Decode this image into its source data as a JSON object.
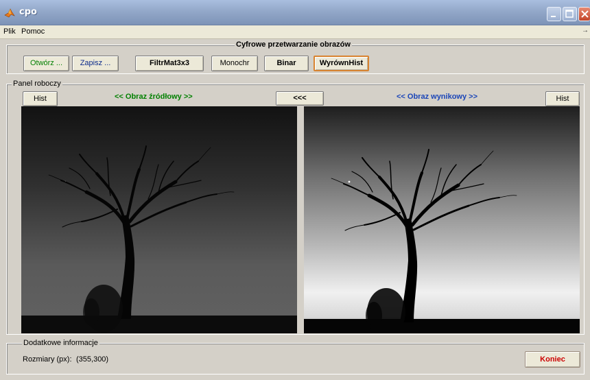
{
  "window": {
    "title": "cpo"
  },
  "menu": {
    "items": [
      "Plik",
      "Pomoc"
    ],
    "overflow_arrow": "→"
  },
  "toolbar": {
    "title": "Cyfrowe przetwarzanie obrazów",
    "open_label": "Otwórz ...",
    "save_label": "Zapisz ...",
    "filter_label": "FiltrMat3x3",
    "mono_label": "Monochr",
    "binar_label": "Binar",
    "histeq_label": "WyrównHist"
  },
  "work": {
    "title": "Panel roboczy",
    "hist_left_label": "Hist",
    "source_label": "<< Obraz źródłowy >>",
    "copy_back_label": "<<<",
    "result_label": "<< Obraz wynikowy >>",
    "hist_right_label": "Hist"
  },
  "info": {
    "title": "Dodatkowe informacje",
    "size_label": "Rozmiary (px):",
    "size_value": "(355,300)",
    "exit_label": "Koniec"
  },
  "colors": {
    "accent": "#d8832f",
    "exit": "#cc0000",
    "source": "#008000",
    "result": "#1a45b8"
  },
  "icons": [
    "matlab-icon",
    "minimize-icon",
    "maximize-icon",
    "close-icon"
  ]
}
